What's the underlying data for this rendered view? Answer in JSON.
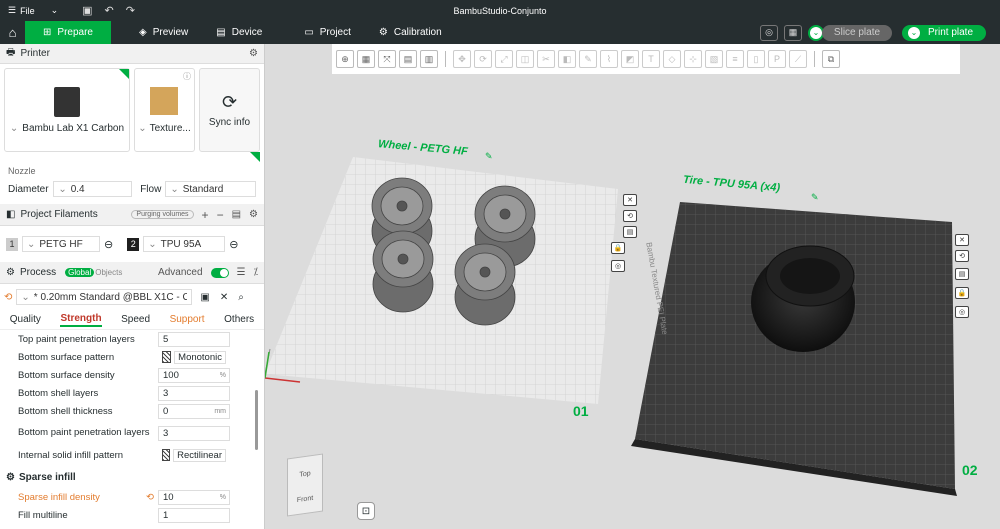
{
  "titlebar": {
    "menu_label": "File",
    "window_title": "BambuStudio-Conjunto"
  },
  "tabs": [
    {
      "label": "Prepare",
      "icon": "prepare-icon"
    },
    {
      "label": "Preview",
      "icon": "preview-icon"
    },
    {
      "label": "Device",
      "icon": "device-icon"
    },
    {
      "label": "Project",
      "icon": "project-icon"
    },
    {
      "label": "Calibration",
      "icon": "calibration-icon"
    }
  ],
  "actions": {
    "slice_label": "Slice plate",
    "print_label": "Print plate"
  },
  "printer": {
    "section_title": "Printer",
    "printer_name": "Bambu Lab X1 Carbon",
    "plate_label": "Texture...",
    "sync_label": "Sync info",
    "nozzle_label": "Nozzle",
    "diameter_label": "Diameter",
    "diameter_value": "0.4",
    "flow_label": "Flow",
    "flow_value": "Standard"
  },
  "filaments": {
    "section_title": "Project Filaments",
    "purging_label": "Purging volumes",
    "items": [
      {
        "num": "1",
        "name": "PETG HF",
        "color": "#555555"
      },
      {
        "num": "2",
        "name": "TPU 95A",
        "color": "#1f1f1f"
      }
    ]
  },
  "process": {
    "section_title": "Process",
    "global_label": "Global",
    "objects_label": "Objects",
    "advanced_label": "Advanced",
    "preset_value": "* 0.20mm Standard @BBL X1C - C...",
    "tabs": [
      "Quality",
      "Strength",
      "Speed",
      "Support",
      "Others"
    ],
    "active_tab": "Strength",
    "settings": [
      {
        "label": "Top paint penetration layers",
        "value": "5"
      },
      {
        "label": "Bottom surface pattern",
        "value": "Monotonic",
        "pattern": true
      },
      {
        "label": "Bottom surface density",
        "value": "100",
        "unit": "%"
      },
      {
        "label": "Bottom shell layers",
        "value": "3"
      },
      {
        "label": "Bottom shell thickness",
        "value": "0",
        "unit": "mm"
      },
      {
        "label": "Bottom paint penetration layers",
        "value": "3"
      },
      {
        "label": "Internal solid infill pattern",
        "value": "Rectilinear",
        "pattern": true
      }
    ],
    "sparse_title": "Sparse infill",
    "sparse_density_label": "Sparse infill density",
    "sparse_density_value": "10",
    "sparse_density_unit": "%",
    "fill_multiline_label": "Fill multiline",
    "fill_multiline_value": "1"
  },
  "plates": {
    "plate1_label": "Wheel - PETG HF",
    "plate1_number": "01",
    "plate2_label": "Tire - TPU 95A (x4)",
    "plate2_number": "02",
    "plate2_texture_text": "Bambu Textured PEI Plate"
  },
  "viewcube": {
    "top": "Top",
    "front": "Front"
  },
  "colors": {
    "accent": "#00ae42",
    "dark": "#262e30",
    "warning": "#e37c2e"
  }
}
